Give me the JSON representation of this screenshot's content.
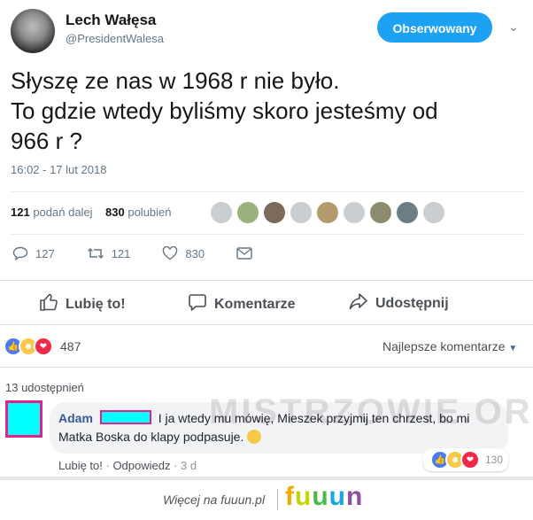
{
  "tweet": {
    "author_name": "Lech Wałęsa",
    "handle": "@PresidentWalesa",
    "follow_label": "Obserwowany",
    "text_line1": "Słyszę ze nas w 1968 r nie było.",
    "text_line2": "To gdzie wtedy byliśmy skoro jesteśmy od",
    "text_line3": "966 r ?",
    "timestamp": "16:02 - 17 lut 2018",
    "retweets_count": "121",
    "retweets_label": "podań dalej",
    "likes_count": "830",
    "likes_label": "polubień",
    "actions": {
      "reply": "127",
      "retweet": "121",
      "like": "830"
    }
  },
  "facebook": {
    "like_label": "Lubię to!",
    "comment_label": "Komentarze",
    "share_label": "Udostępnij",
    "reactions_count": "487",
    "sort_label": "Najlepsze komentarze",
    "shares_label": "13 udostępnień",
    "comment": {
      "author": "Adam",
      "text": "I ja wtedy mu mówię, Mieszek przyjmij ten chrzest, bo mi Matka Boska do klapy podpasuje.",
      "like_link": "Lubię to!",
      "reply_link": "Odpowiedz",
      "age": "3 d",
      "reactions_count": "130"
    },
    "colors": {
      "like_blue": "#4b7bf0",
      "haha_yellow": "#f7c84a",
      "love_red": "#f0284a"
    }
  },
  "watermark": "MISTRZOWIE.ORG",
  "footer": {
    "more_label": "Więcej na fuuun.pl",
    "logo": "fuuun"
  }
}
